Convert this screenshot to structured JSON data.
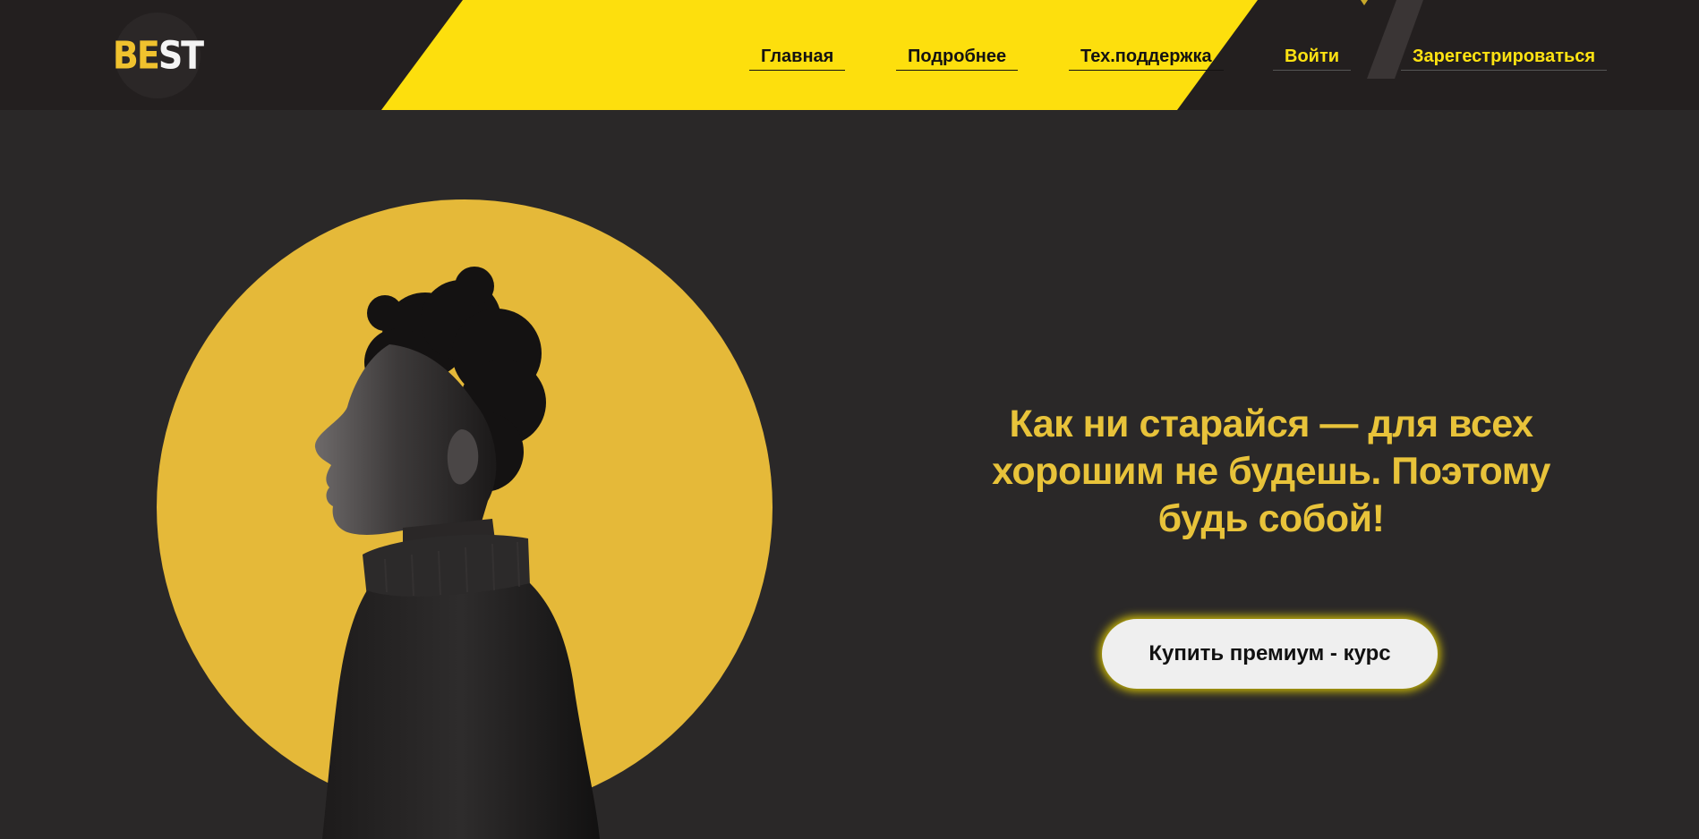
{
  "header": {
    "logo": {
      "part1": "BE",
      "part2": "ST"
    },
    "nav": [
      {
        "label": "Главная"
      },
      {
        "label": "Подробнее"
      },
      {
        "label": "Тех.поддержка"
      },
      {
        "label": "Войти"
      },
      {
        "label": "Зарегестрироваться"
      }
    ]
  },
  "hero": {
    "headline": "Как ни старайся — для всех хорошим не будешь. Поэтому будь собой!",
    "cta_label": "Купить премиум - курс",
    "image": "person-profile-portrait"
  },
  "colors": {
    "background": "#2a2828",
    "header_background": "#231f1f",
    "accent_yellow": "#fddf0d",
    "circle_yellow": "#e5b939",
    "headline_yellow": "#e8c33a",
    "button_background": "#efefef"
  }
}
